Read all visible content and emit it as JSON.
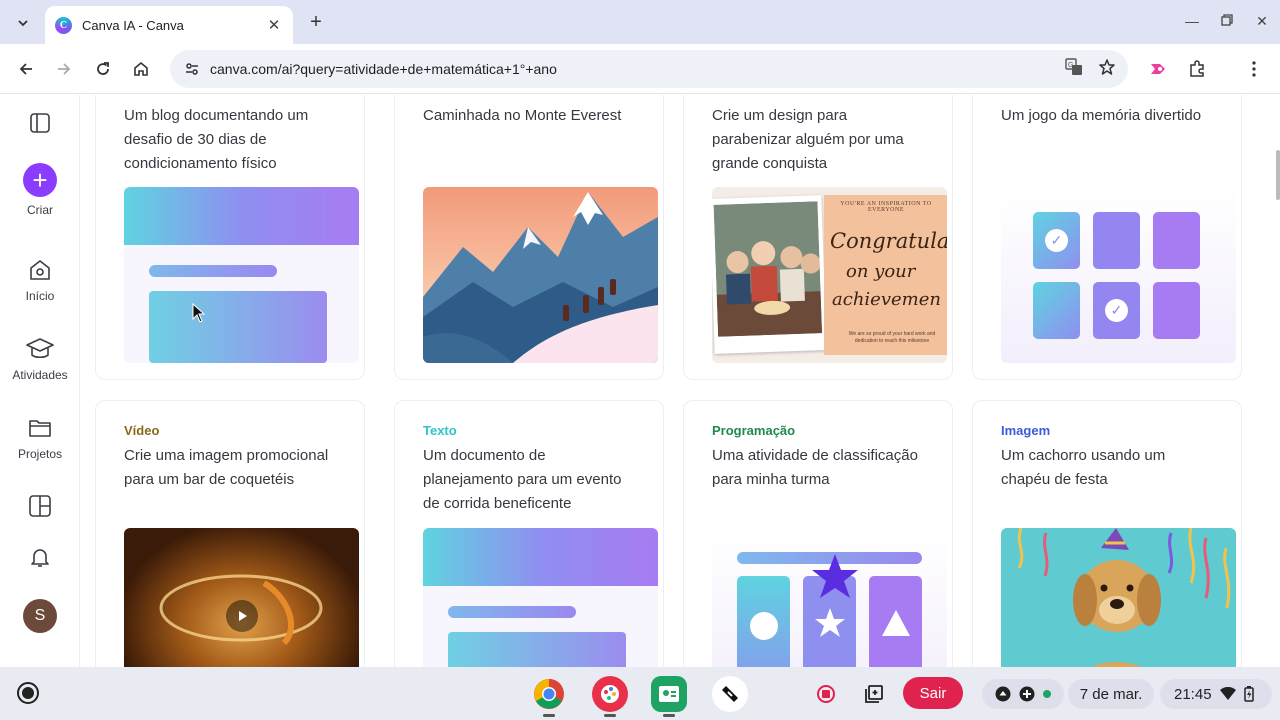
{
  "browser": {
    "tab_title": "Canva IA - Canva",
    "favicon_letter": "C",
    "url": "canva.com/ai?query=atividade+de+matemática+1°+ano"
  },
  "sidebar": {
    "items": [
      {
        "label": "Criar",
        "icon": "plus-icon"
      },
      {
        "label": "Início",
        "icon": "home-icon"
      },
      {
        "label": "Atividades",
        "icon": "graduation-cap-icon"
      },
      {
        "label": "Projetos",
        "icon": "folder-icon"
      },
      {
        "label": "",
        "icon": "apps-icon"
      },
      {
        "label": "",
        "icon": "bell-icon"
      }
    ],
    "avatar_letter": "S"
  },
  "cards_row1": [
    {
      "text": "Um blog documentando um desafio de 30 dias de condicionamento físico"
    },
    {
      "text": "Caminhada no Monte Everest"
    },
    {
      "text": "Crie um design para parabenizar alguém por uma grande conquista"
    },
    {
      "text": "Um jogo da memória divertido"
    }
  ],
  "cards_row2": [
    {
      "tag": "Vídeo",
      "tag_color": "#8a6a1a",
      "text": "Crie uma imagem promocional para um bar de coquetéis"
    },
    {
      "tag": "Texto",
      "tag_color": "#2cc5c9",
      "text": "Um documento de planejamento para um evento de corrida beneficente"
    },
    {
      "tag": "Programação",
      "tag_color": "#1f8a4c",
      "text": "Uma atividade de classificação para minha turma"
    },
    {
      "tag": "Imagem",
      "tag_color": "#3b5bdb",
      "text": "Um cachorro usando um chapéu de festa"
    }
  ],
  "congrats_card": {
    "top": "YOU'RE AN INSPIRATION TO EVERYONE",
    "script_1": "Congratulat",
    "script_2": "on your",
    "script_3": "achievemen",
    "bottom": "We are so proud of your hard work and dedication to reach this milestone"
  },
  "shelf": {
    "sair_label": "Sair",
    "date": "7 de mar.",
    "time": "21:45"
  },
  "colors": {
    "canva_purple": "#8b3dff",
    "gradient_start": "#5fd3e0",
    "gradient_end": "#a77cf2"
  }
}
